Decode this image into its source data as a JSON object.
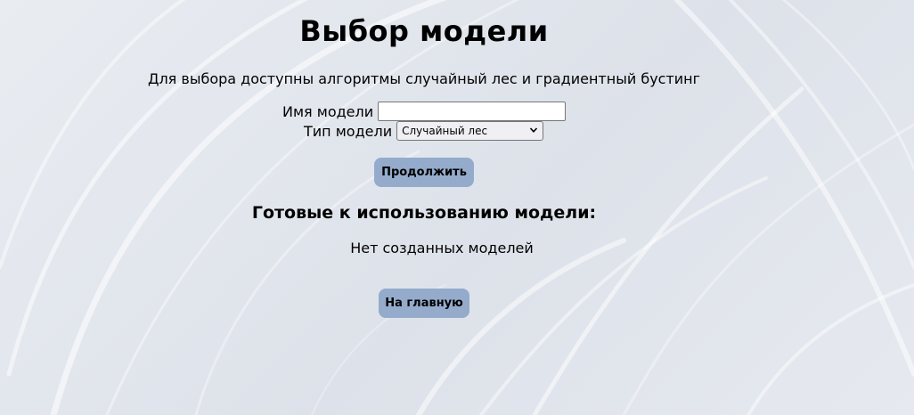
{
  "page": {
    "title": "Выбор модели",
    "subtitle": "Для выбора доступны алгоритмы случайный лес и градиентный бустинг"
  },
  "form": {
    "name_label": "Имя модели",
    "name_value": "",
    "type_label": "Тип модели",
    "type_selected": "Случайный лес",
    "continue_label": "Продолжить"
  },
  "models": {
    "heading": "Готовые к использованию модели:",
    "empty_message": "Нет созданных моделей"
  },
  "nav": {
    "home_label": "На главную"
  },
  "colors": {
    "button_bg": "#94abcb",
    "background": "#e3e7ee"
  },
  "icons": {
    "select_arrow": "chevron-down-icon"
  }
}
